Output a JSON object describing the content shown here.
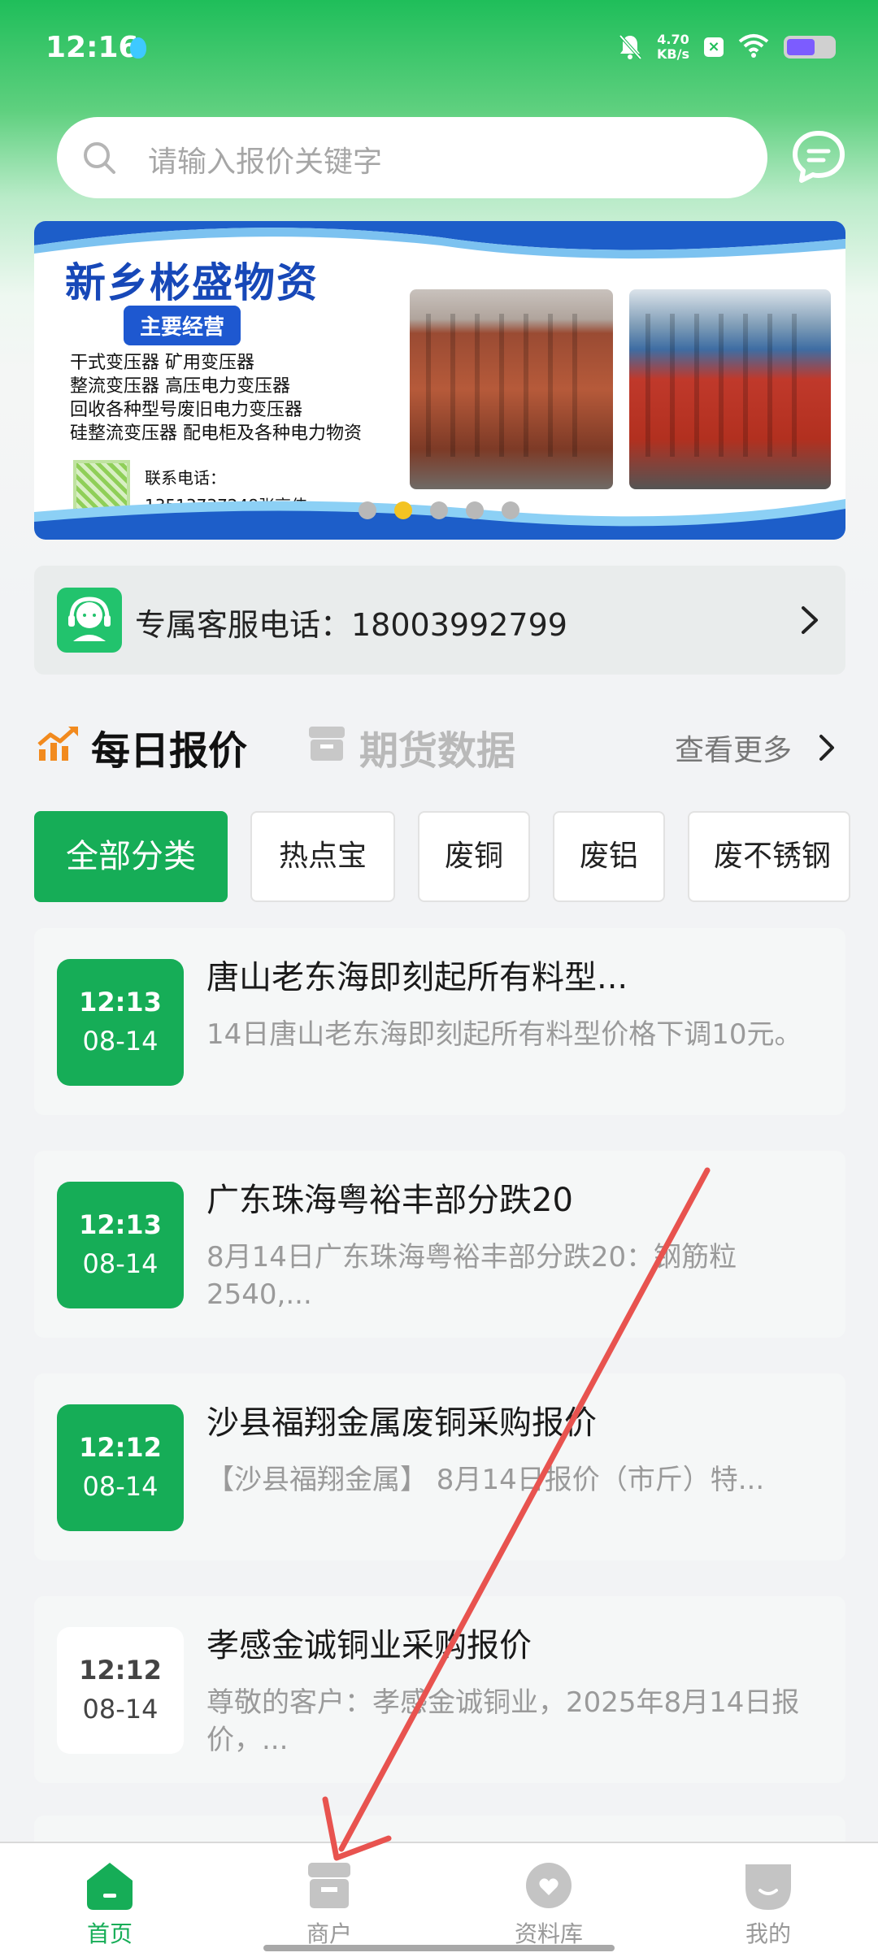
{
  "status_bar": {
    "time": "12:16",
    "net_speed_value": "4.70",
    "net_speed_unit": "KB/s",
    "icons": [
      "mute-icon",
      "x-app-icon",
      "wifi-icon",
      "battery-icon"
    ]
  },
  "search": {
    "placeholder": "请输入报价关键字"
  },
  "banner": {
    "title": "新乡彬盛物资",
    "badge": "主要经营",
    "lines": [
      "干式变压器      矿用变压器",
      "整流变压器      高压电力变压器",
      "回收各种型号废旧电力变压器",
      "硅整流变压器  配电柜及各种电力物资"
    ],
    "contact_label": "联系电话：",
    "contact_phone": "13513737248张高伟",
    "dots_total": 5,
    "active_dot": 2
  },
  "service": {
    "text": "专属客服电话：18003992799"
  },
  "section_tabs": {
    "daily": "每日报价",
    "futures": "期货数据",
    "view_more": "查看更多"
  },
  "chips": [
    {
      "label": "全部分类",
      "active": true
    },
    {
      "label": "热点宝",
      "active": false
    },
    {
      "label": "废铜",
      "active": false
    },
    {
      "label": "废铝",
      "active": false
    },
    {
      "label": "废不锈钢",
      "active": false
    }
  ],
  "news": [
    {
      "time": "12:13",
      "date": "08-14",
      "title": "唐山老东海即刻起所有料型...",
      "summary": "14日唐山老东海即刻起所有料型价格下调10元。",
      "highlight": true
    },
    {
      "time": "12:13",
      "date": "08-14",
      "title": "广东珠海粤裕丰部分跌20",
      "summary": "8月14日广东珠海粤裕丰部分跌20：钢筋粒2540,...",
      "highlight": true
    },
    {
      "time": "12:12",
      "date": "08-14",
      "title": "沙县福翔金属废铜采购报价",
      "summary": "【沙县福翔金属】 8月14日报价（市斤）特...",
      "highlight": true
    },
    {
      "time": "12:12",
      "date": "08-14",
      "title": "孝感金诚铜业采购报价",
      "summary": "尊敬的客户：孝感金诚铜业，2025年8月14日报价，...",
      "highlight": false
    }
  ],
  "bottom_nav": [
    {
      "label": "首页",
      "icon": "home-icon",
      "active": true
    },
    {
      "label": "商户",
      "icon": "shop-icon",
      "active": false
    },
    {
      "label": "资料库",
      "icon": "library-heart-icon",
      "active": false
    },
    {
      "label": "我的",
      "icon": "profile-icon",
      "active": false
    }
  ],
  "colors": {
    "brand_green": "#16ad57",
    "annotation_red": "#e8534f"
  }
}
